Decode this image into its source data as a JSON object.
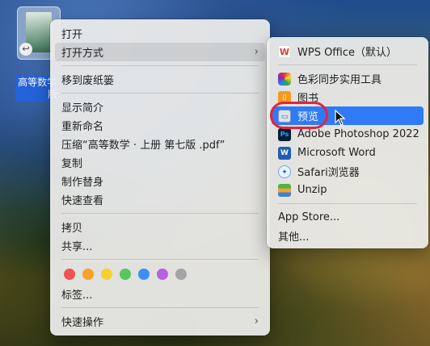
{
  "desktop": {
    "file_label_line1": "高等数学·",
    "file_label_line2": "版"
  },
  "main_menu": {
    "open": "打开",
    "open_with": "打开方式",
    "move_to_trash": "移到废纸篓",
    "get_info": "显示简介",
    "rename": "重新命名",
    "compress": "压缩“高等数学 · 上册 第七版 .pdf”",
    "duplicate": "复制",
    "make_alias": "制作替身",
    "quick_look": "快速查看",
    "copy": "拷贝",
    "share": "共享...",
    "tags": "标签...",
    "quick_actions": "快速操作",
    "tag_colors": [
      "#f05353",
      "#f6a32c",
      "#f6d12e",
      "#5ac65b",
      "#3d8ef7",
      "#b763db",
      "#a4a4a4"
    ]
  },
  "open_with_menu": {
    "items": [
      {
        "label": "WPS Office（默认）",
        "icon": "wps-icon"
      },
      {
        "label": "色彩同步实用工具",
        "icon": "colorsync-icon"
      },
      {
        "label": "图书",
        "icon": "books-icon"
      },
      {
        "label": "预览",
        "icon": "preview-icon"
      },
      {
        "label": "Adobe Photoshop 2022",
        "icon": "photoshop-icon"
      },
      {
        "label": "Microsoft Word",
        "icon": "word-icon"
      },
      {
        "label": "Safari浏览器",
        "icon": "safari-icon"
      },
      {
        "label": "Unzip",
        "icon": "unzip-icon"
      }
    ],
    "app_store": "App Store...",
    "other": "其他..."
  },
  "colors": {
    "highlight": "#2f7bf6",
    "annotation_ring": "#e8213b"
  }
}
